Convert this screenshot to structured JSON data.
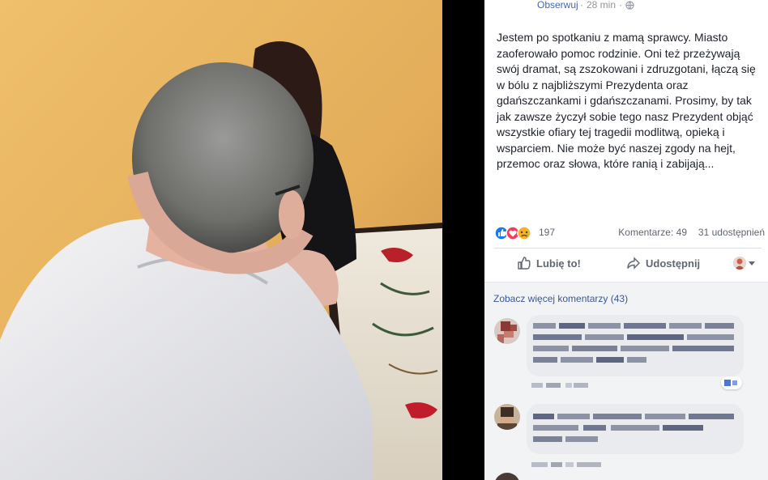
{
  "post": {
    "follow_label": "Obserwuj",
    "time": "28 min",
    "separator": "·",
    "text": "Jestem po spotkaniu z mamą sprawcy. Miasto zaoferowało pomoc rodzinie. Oni też przeżywają swój dramat, są zszokowani i zdruzgotani, łączą się w bólu z najbliższymi Prezydenta oraz gdańszczankami i gdańszczanami. Prosimy, by tak jak zawsze życzył sobie tego nasz Prezydent objąć wszystkie ofiary tej tragedii modlitwą, opieką i wsparciem. Nie może być naszej zgody na hejt, przemoc oraz słowa, które ranią i zabijają..."
  },
  "stats": {
    "reaction_count": "197",
    "comments": "Komentarze: 49",
    "shares": "31 udostępnień"
  },
  "actions": {
    "like_label": "Lubię to!",
    "share_label": "Udostępnij"
  },
  "comments_section": {
    "see_more": "Zobacz więcej komentarzy (43)"
  },
  "colors": {
    "link": "#4267b2",
    "text": "#1d2129",
    "muted": "#90949c",
    "like_blue": "#1877f2",
    "love_red": "#f33e58",
    "sad_yellow": "#f7b125"
  },
  "icons": {
    "globe": "globe-icon",
    "like": "thumbs-up-icon",
    "share": "share-arrow-icon",
    "reactions": [
      "like-reaction-icon",
      "love-reaction-icon",
      "sad-reaction-icon"
    ]
  }
}
